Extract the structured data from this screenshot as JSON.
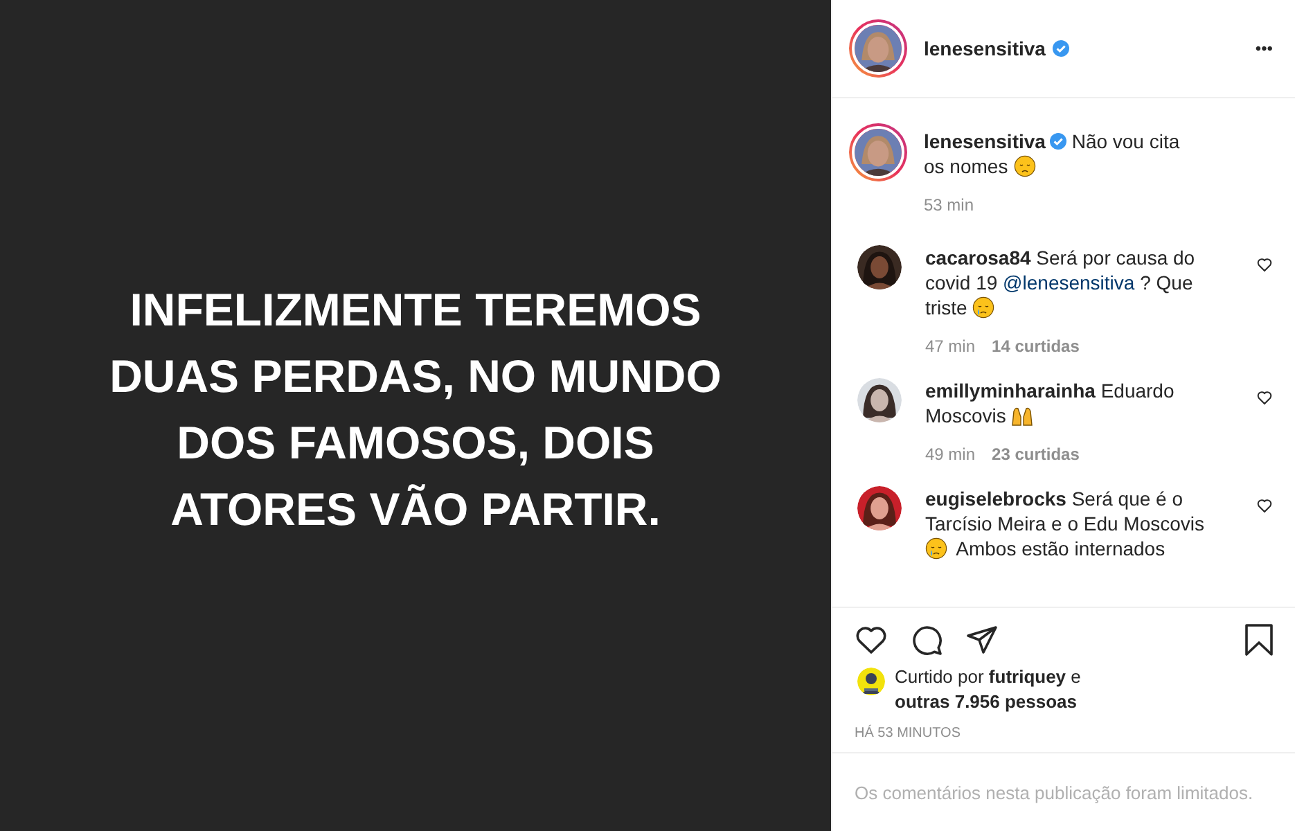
{
  "post_image": {
    "text": "INFELIZMENTE TEREMOS DUAS PERDAS, NO MUNDO DOS FAMOSOS, DOIS ATORES VÃO PARTIR."
  },
  "header": {
    "username": "lenesensitiva",
    "verified": true,
    "more": "•••"
  },
  "caption": {
    "username": "lenesensitiva",
    "verified": true,
    "parts": [
      {
        "kind": "text",
        "text": "Não vou cita os nomes"
      },
      {
        "kind": "pensive"
      }
    ],
    "time": "53 min"
  },
  "comments": [
    {
      "username": "cacarosa84",
      "parts": [
        {
          "kind": "text",
          "text": "Será por causa do covid 19"
        },
        {
          "kind": "mention",
          "text": "@lenesensitiva"
        },
        {
          "kind": "text",
          "text": "? Que triste"
        },
        {
          "kind": "crying"
        }
      ],
      "time": "47 min",
      "likes": "14 curtidas"
    },
    {
      "username": "emillyminharainha",
      "parts": [
        {
          "kind": "text",
          "text": "Eduardo Moscovis"
        },
        {
          "kind": "hands"
        }
      ],
      "time": "49 min",
      "likes": "23 curtidas"
    },
    {
      "username": "eugiselebrocks",
      "parts": [
        {
          "kind": "text",
          "text": "Será que é o Tarcísio Meira e o Edu Moscovis"
        },
        {
          "kind": "crying"
        },
        {
          "kind": "text",
          "text": "Ambos estão internados"
        }
      ]
    }
  ],
  "likes": {
    "text": "Curtido por **futriquey** e **outras 7.956 pessoas**"
  },
  "timestamp": "HÁ 53 MINUTOS",
  "footer": "Os comentários nesta publicação foram limitados."
}
